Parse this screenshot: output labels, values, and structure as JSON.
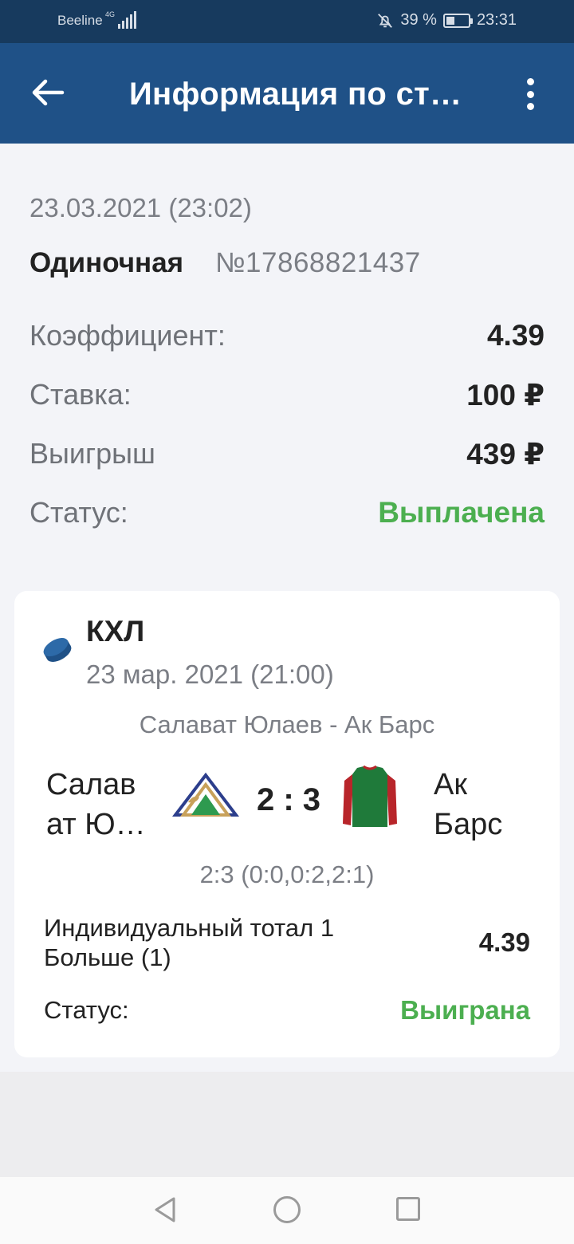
{
  "status_bar": {
    "carrier": "Beeline",
    "network": "4G",
    "battery_level": 0.39,
    "battery_text": "39 %",
    "time": "23:31"
  },
  "app_bar": {
    "title": "Информация по ст…",
    "back_icon": "arrow-left-icon",
    "menu_icon": "more-vert-icon"
  },
  "bet": {
    "datetime": "23.03.2021 (23:02)",
    "type": "Одиночная",
    "number": "№17868821437",
    "rows": [
      {
        "label": "Коэффициент:",
        "value": "4.39"
      },
      {
        "label": "Ставка:",
        "value": "100 ₽"
      },
      {
        "label": "Выигрыш",
        "value": "439 ₽"
      },
      {
        "label": "Статус:",
        "value": "Выплачена"
      }
    ],
    "status_color": "#4caf50"
  },
  "event": {
    "sport_icon": "hockey-puck-icon",
    "league": "КХЛ",
    "date": "23 мар. 2021 (21:00)",
    "match": "Салават Юлаев - Ак Барс",
    "team1": "Салават Ю…",
    "team2": "Ак Барс",
    "score": "2 : 3",
    "periods": "2:3 (0:0,0:2,2:1)",
    "market": "Индивидуальный тотал 1 Больше (1)",
    "odd": "4.39",
    "status_label": "Статус:",
    "status_value": "Выиграна"
  },
  "accent_colors": {
    "header": "#1f5187",
    "status_bar": "#173a5e",
    "success": "#4caf50"
  }
}
